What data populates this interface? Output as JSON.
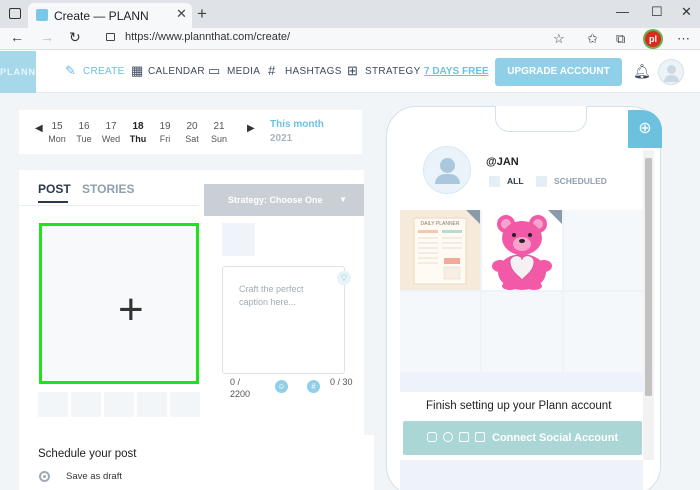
{
  "browser": {
    "tab_title": "Create — PLANN",
    "url": "https://www.plannthat.com/create/",
    "window_controls": [
      "minimize",
      "maximize",
      "close"
    ],
    "profile_initials": "pl"
  },
  "app": {
    "logo": "PLANN",
    "nav": [
      {
        "label": "CREATE",
        "icon": "pencil-icon",
        "active": true
      },
      {
        "label": "CALENDAR",
        "icon": "calendar-icon",
        "active": false
      },
      {
        "label": "MEDIA",
        "icon": "folder-icon",
        "active": false
      },
      {
        "label": "HASHTAGS",
        "icon": "hash-icon",
        "active": false
      },
      {
        "label": "STRATEGY",
        "icon": "grid-icon",
        "active": false
      }
    ],
    "free_link": "7 DAYS FREE",
    "upgrade_label": "UPGRADE ACCOUNT"
  },
  "dates": {
    "days": [
      {
        "n": "15",
        "w": "Mon"
      },
      {
        "n": "16",
        "w": "Tue"
      },
      {
        "n": "17",
        "w": "Wed"
      },
      {
        "n": "18",
        "w": "Thu",
        "selected": true
      },
      {
        "n": "19",
        "w": "Fri"
      },
      {
        "n": "20",
        "w": "Sat"
      },
      {
        "n": "21",
        "w": "Sun"
      }
    ],
    "month_label": "This month",
    "year": "2021"
  },
  "post": {
    "tabs": [
      "POST",
      "STORIES"
    ],
    "strategy": "Strategy: Choose One",
    "caption_placeholder": "Craft the perfect caption here...",
    "chars": "0 / 2200",
    "hashtags": "0 / 30",
    "schedule_title": "Schedule your post",
    "save_draft": "Save as draft"
  },
  "preview": {
    "handle": "@JAN",
    "filters": [
      "ALL",
      "SCHEDULED"
    ],
    "planner_text": "DAILY PLANNER",
    "finish": "Finish setting up your Plann account",
    "connect": "Connect Social Account"
  },
  "colors": {
    "accent": "#6cc1df",
    "upgrade": "#8fd0e8",
    "highlight": "#1de21d",
    "connect": "#aad7d6"
  }
}
